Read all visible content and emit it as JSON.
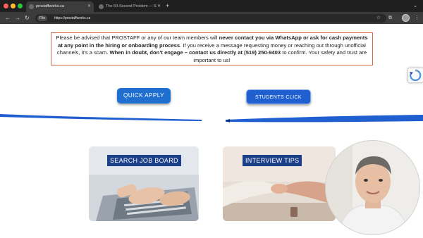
{
  "browser": {
    "tabs": [
      {
        "label": "prostaffworks.ca",
        "active": true
      },
      {
        "label": "The 60-Second Problem — S",
        "active": false
      }
    ],
    "new_tab_icon": "plus-icon",
    "url_chip": "File",
    "url": "https://prostaffworks.ca"
  },
  "notice": {
    "p1": "Please be advised that PROSTAFF or any of our team members will ",
    "b1": "never contact you via WhatsApp or ask for cash payments at any point in the hiring or onboarding process",
    "p2": ".  If you receive a message requesting money or reaching out through unofficial channels, it’s a scam.  ",
    "b2": "When in doubt, don’t engage – contact us directly at (519) 250-9403",
    "p3": " to confirm.  Your safety and trust are important to us!"
  },
  "buttons": {
    "quick_apply": "QUICK APPLY",
    "students": "STUDENTS CLICK HERE!"
  },
  "cards": {
    "job_board": "SEARCH JOB BOARD",
    "interview_tips": "INTERVIEW TIPS"
  },
  "colors": {
    "accent_blue": "#1f6fd1",
    "label_navy": "#1c3f8a",
    "notice_border": "#d46a4a"
  }
}
